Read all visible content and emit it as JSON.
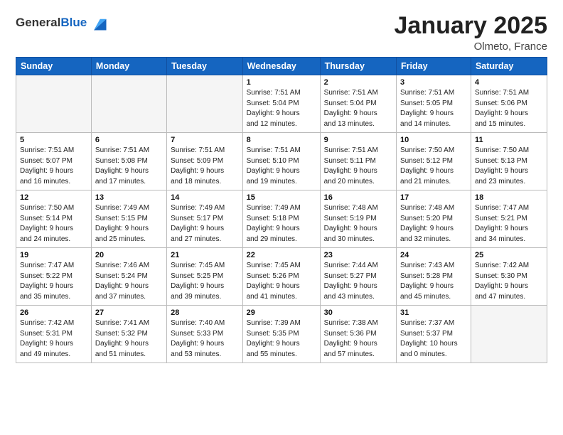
{
  "header": {
    "logo_general": "General",
    "logo_blue": "Blue",
    "month": "January 2025",
    "location": "Olmeto, France"
  },
  "weekdays": [
    "Sunday",
    "Monday",
    "Tuesday",
    "Wednesday",
    "Thursday",
    "Friday",
    "Saturday"
  ],
  "weeks": [
    [
      {
        "day": "",
        "info": ""
      },
      {
        "day": "",
        "info": ""
      },
      {
        "day": "",
        "info": ""
      },
      {
        "day": "1",
        "info": "Sunrise: 7:51 AM\nSunset: 5:04 PM\nDaylight: 9 hours\nand 12 minutes."
      },
      {
        "day": "2",
        "info": "Sunrise: 7:51 AM\nSunset: 5:04 PM\nDaylight: 9 hours\nand 13 minutes."
      },
      {
        "day": "3",
        "info": "Sunrise: 7:51 AM\nSunset: 5:05 PM\nDaylight: 9 hours\nand 14 minutes."
      },
      {
        "day": "4",
        "info": "Sunrise: 7:51 AM\nSunset: 5:06 PM\nDaylight: 9 hours\nand 15 minutes."
      }
    ],
    [
      {
        "day": "5",
        "info": "Sunrise: 7:51 AM\nSunset: 5:07 PM\nDaylight: 9 hours\nand 16 minutes."
      },
      {
        "day": "6",
        "info": "Sunrise: 7:51 AM\nSunset: 5:08 PM\nDaylight: 9 hours\nand 17 minutes."
      },
      {
        "day": "7",
        "info": "Sunrise: 7:51 AM\nSunset: 5:09 PM\nDaylight: 9 hours\nand 18 minutes."
      },
      {
        "day": "8",
        "info": "Sunrise: 7:51 AM\nSunset: 5:10 PM\nDaylight: 9 hours\nand 19 minutes."
      },
      {
        "day": "9",
        "info": "Sunrise: 7:51 AM\nSunset: 5:11 PM\nDaylight: 9 hours\nand 20 minutes."
      },
      {
        "day": "10",
        "info": "Sunrise: 7:50 AM\nSunset: 5:12 PM\nDaylight: 9 hours\nand 21 minutes."
      },
      {
        "day": "11",
        "info": "Sunrise: 7:50 AM\nSunset: 5:13 PM\nDaylight: 9 hours\nand 23 minutes."
      }
    ],
    [
      {
        "day": "12",
        "info": "Sunrise: 7:50 AM\nSunset: 5:14 PM\nDaylight: 9 hours\nand 24 minutes."
      },
      {
        "day": "13",
        "info": "Sunrise: 7:49 AM\nSunset: 5:15 PM\nDaylight: 9 hours\nand 25 minutes."
      },
      {
        "day": "14",
        "info": "Sunrise: 7:49 AM\nSunset: 5:17 PM\nDaylight: 9 hours\nand 27 minutes."
      },
      {
        "day": "15",
        "info": "Sunrise: 7:49 AM\nSunset: 5:18 PM\nDaylight: 9 hours\nand 29 minutes."
      },
      {
        "day": "16",
        "info": "Sunrise: 7:48 AM\nSunset: 5:19 PM\nDaylight: 9 hours\nand 30 minutes."
      },
      {
        "day": "17",
        "info": "Sunrise: 7:48 AM\nSunset: 5:20 PM\nDaylight: 9 hours\nand 32 minutes."
      },
      {
        "day": "18",
        "info": "Sunrise: 7:47 AM\nSunset: 5:21 PM\nDaylight: 9 hours\nand 34 minutes."
      }
    ],
    [
      {
        "day": "19",
        "info": "Sunrise: 7:47 AM\nSunset: 5:22 PM\nDaylight: 9 hours\nand 35 minutes."
      },
      {
        "day": "20",
        "info": "Sunrise: 7:46 AM\nSunset: 5:24 PM\nDaylight: 9 hours\nand 37 minutes."
      },
      {
        "day": "21",
        "info": "Sunrise: 7:45 AM\nSunset: 5:25 PM\nDaylight: 9 hours\nand 39 minutes."
      },
      {
        "day": "22",
        "info": "Sunrise: 7:45 AM\nSunset: 5:26 PM\nDaylight: 9 hours\nand 41 minutes."
      },
      {
        "day": "23",
        "info": "Sunrise: 7:44 AM\nSunset: 5:27 PM\nDaylight: 9 hours\nand 43 minutes."
      },
      {
        "day": "24",
        "info": "Sunrise: 7:43 AM\nSunset: 5:28 PM\nDaylight: 9 hours\nand 45 minutes."
      },
      {
        "day": "25",
        "info": "Sunrise: 7:42 AM\nSunset: 5:30 PM\nDaylight: 9 hours\nand 47 minutes."
      }
    ],
    [
      {
        "day": "26",
        "info": "Sunrise: 7:42 AM\nSunset: 5:31 PM\nDaylight: 9 hours\nand 49 minutes."
      },
      {
        "day": "27",
        "info": "Sunrise: 7:41 AM\nSunset: 5:32 PM\nDaylight: 9 hours\nand 51 minutes."
      },
      {
        "day": "28",
        "info": "Sunrise: 7:40 AM\nSunset: 5:33 PM\nDaylight: 9 hours\nand 53 minutes."
      },
      {
        "day": "29",
        "info": "Sunrise: 7:39 AM\nSunset: 5:35 PM\nDaylight: 9 hours\nand 55 minutes."
      },
      {
        "day": "30",
        "info": "Sunrise: 7:38 AM\nSunset: 5:36 PM\nDaylight: 9 hours\nand 57 minutes."
      },
      {
        "day": "31",
        "info": "Sunrise: 7:37 AM\nSunset: 5:37 PM\nDaylight: 10 hours\nand 0 minutes."
      },
      {
        "day": "",
        "info": ""
      }
    ]
  ]
}
